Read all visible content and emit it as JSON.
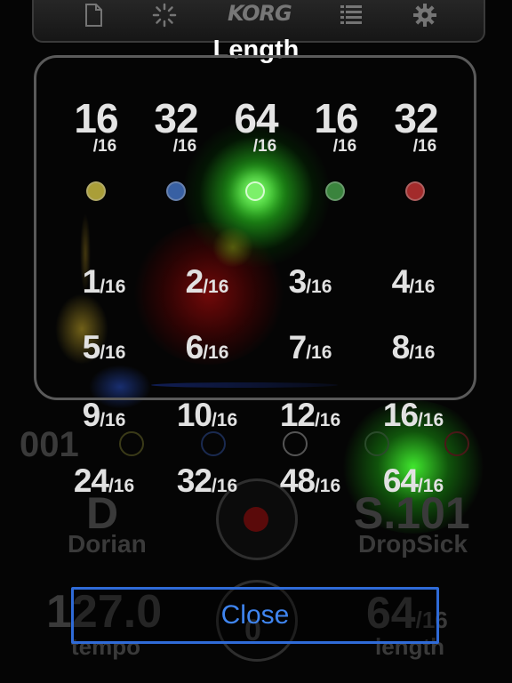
{
  "toolbar": {
    "logo": "KORG",
    "icons": [
      "document-icon",
      "sync-icon",
      "list-icon",
      "gear-icon"
    ]
  },
  "background": {
    "pattern_number": "001",
    "scale_key": "D",
    "scale_name": "Dorian",
    "preset_code": "S.101",
    "preset_name": "DropSick",
    "tempo_value": "127.0",
    "tempo_label": "tempo",
    "length_value": "64",
    "length_denominator": "/16",
    "length_label": "length",
    "center_value": "0"
  },
  "dialog": {
    "title": "Length",
    "patterns": [
      {
        "value": "16",
        "denominator": "/16",
        "color": "#e2d24a"
      },
      {
        "value": "32",
        "denominator": "/16",
        "color": "#4a7fd8"
      },
      {
        "value": "64",
        "denominator": "/16",
        "color": "#7cf06a"
      },
      {
        "value": "16",
        "denominator": "/16",
        "color": "#4caf50"
      },
      {
        "value": "32",
        "denominator": "/16",
        "color": "#d83838"
      }
    ],
    "selected_pattern": 2,
    "options": [
      {
        "n": "1",
        "d": "/16"
      },
      {
        "n": "2",
        "d": "/16"
      },
      {
        "n": "3",
        "d": "/16"
      },
      {
        "n": "4",
        "d": "/16"
      },
      {
        "n": "5",
        "d": "/16"
      },
      {
        "n": "6",
        "d": "/16"
      },
      {
        "n": "7",
        "d": "/16"
      },
      {
        "n": "8",
        "d": "/16"
      },
      {
        "n": "9",
        "d": "/16"
      },
      {
        "n": "10",
        "d": "/16"
      },
      {
        "n": "12",
        "d": "/16"
      },
      {
        "n": "16",
        "d": "/16"
      },
      {
        "n": "24",
        "d": "/16"
      },
      {
        "n": "32",
        "d": "/16"
      },
      {
        "n": "48",
        "d": "/16"
      },
      {
        "n": "64",
        "d": "/16"
      }
    ],
    "close_label": "Close",
    "accent_color": "#3f85f0"
  }
}
